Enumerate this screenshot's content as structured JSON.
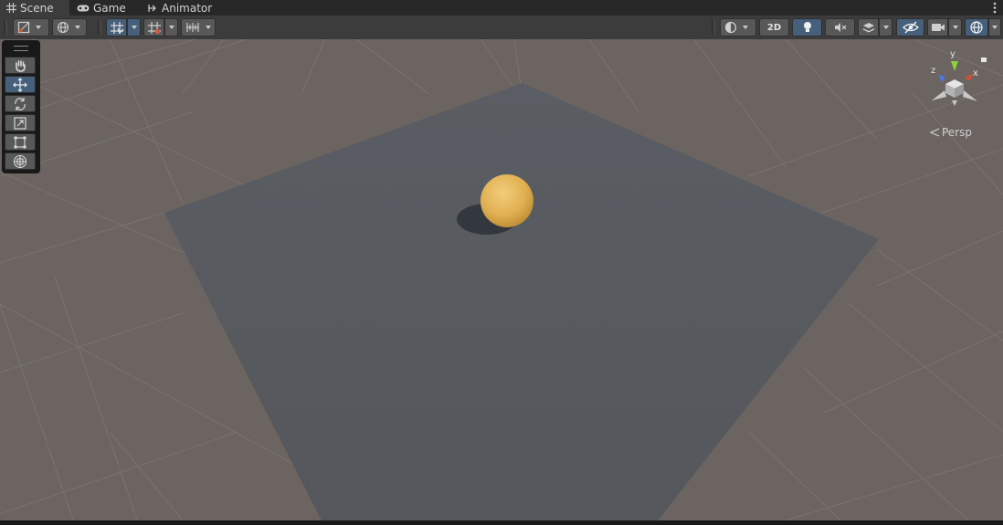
{
  "tabs": [
    {
      "label": "Scene",
      "icon": "grid-icon",
      "active": true
    },
    {
      "label": "Game",
      "icon": "gamepad-icon",
      "active": false
    },
    {
      "label": "Animator",
      "icon": "animator-icon",
      "active": false
    }
  ],
  "toolbar": {
    "two_d_label": "2D"
  },
  "tools": [
    "hand-tool",
    "move-tool",
    "rotate-tool",
    "scale-tool",
    "rect-tool",
    "transform-tool"
  ],
  "active_tool": "move-tool",
  "gizmo": {
    "y_label": "y",
    "x_label": "x",
    "z_label": "z",
    "projection_label": "Persp"
  },
  "colors": {
    "ground": "#6b6460",
    "plane": "#55585d",
    "sphere": "#e0b052",
    "accent": "#46607c"
  }
}
